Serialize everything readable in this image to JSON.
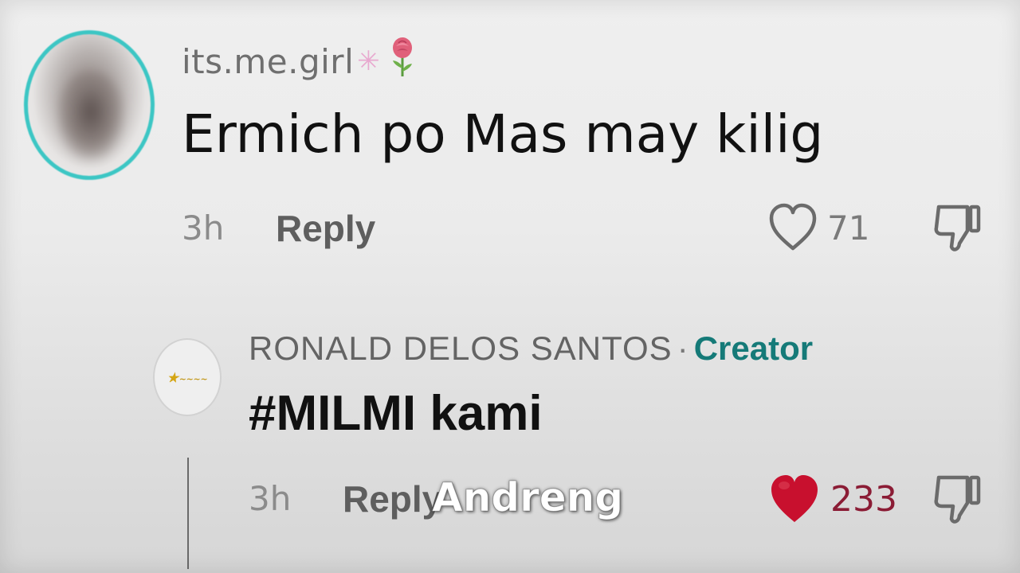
{
  "comments": [
    {
      "username": "its.me.girl",
      "username_emojis": [
        "sparkle-star",
        "rose"
      ],
      "avatar_ring_color": "#3cc6c4",
      "text": "Ermich po Mas may kilig",
      "time": "3h",
      "reply_label": "Reply",
      "likes": "71",
      "liked": false
    }
  ],
  "reply": {
    "username": "RONALD DELOS SANTOS",
    "separator": "·",
    "badge": "Creator",
    "badge_color": "#157a78",
    "text": "#MILMI kami",
    "time": "3h",
    "reply_label": "Reply",
    "likes": "233",
    "liked": true,
    "like_color": "#c8102e"
  },
  "subtitle": "Andreng"
}
